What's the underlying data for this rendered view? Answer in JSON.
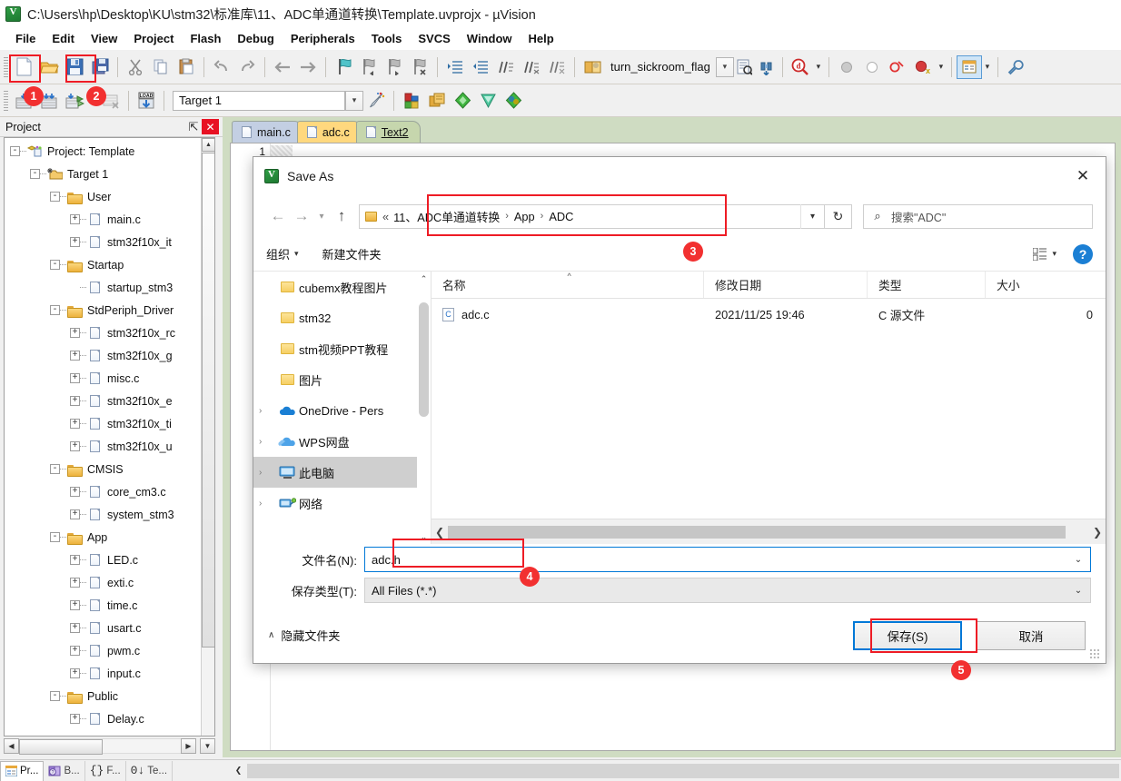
{
  "window": {
    "title": "C:\\Users\\hp\\Desktop\\KU\\stm32\\标准库\\11、ADC单通道转换\\Template.uvprojx - µVision",
    "app_icon": "keil-uvision-icon"
  },
  "menubar": {
    "items": [
      "File",
      "Edit",
      "View",
      "Project",
      "Flash",
      "Debug",
      "Peripherals",
      "Tools",
      "SVCS",
      "Window",
      "Help"
    ]
  },
  "toolbar1": {
    "buttons": [
      {
        "name": "new-file-button",
        "icon": "new-document-icon"
      },
      {
        "name": "open-file-button",
        "icon": "open-folder-icon"
      },
      {
        "name": "save-button",
        "icon": "floppy-save-icon"
      },
      {
        "name": "save-all-button",
        "icon": "save-all-icon"
      },
      {
        "name": "cut-button",
        "icon": "scissors-icon"
      },
      {
        "name": "copy-button",
        "icon": "copy-icon"
      },
      {
        "name": "paste-button",
        "icon": "paste-icon"
      },
      {
        "name": "undo-button",
        "icon": "undo-arrow-icon"
      },
      {
        "name": "redo-button",
        "icon": "redo-arrow-icon"
      },
      {
        "name": "navigate-back-button",
        "icon": "arrow-left-icon"
      },
      {
        "name": "navigate-forward-button",
        "icon": "arrow-right-icon"
      },
      {
        "name": "bookmark-toggle-button",
        "icon": "bookmark-flag-icon"
      },
      {
        "name": "bookmark-prev-button",
        "icon": "bookmark-prev-icon"
      },
      {
        "name": "bookmark-next-button",
        "icon": "bookmark-next-icon"
      },
      {
        "name": "bookmark-clear-button",
        "icon": "bookmark-clear-icon"
      },
      {
        "name": "indent-button",
        "icon": "indent-right-icon"
      },
      {
        "name": "outdent-button",
        "icon": "indent-left-icon"
      },
      {
        "name": "comment-button",
        "icon": "comment-lines-icon"
      },
      {
        "name": "uncomment-button",
        "icon": "uncomment-lines-icon"
      },
      {
        "name": "uncomment-alt-button",
        "icon": "uncomment-alt-icon"
      }
    ],
    "flag_value": "turn_sickroom_flag",
    "right_buttons": [
      {
        "name": "insert-file-button",
        "icon": "book-open-icon"
      },
      {
        "name": "find-in-files-button",
        "icon": "find-document-icon"
      },
      {
        "name": "find-next-button",
        "icon": "binoculars-icon"
      },
      {
        "name": "debug-query-button",
        "icon": "magnifier-q-icon"
      },
      {
        "name": "breakpoint-set-button",
        "icon": "grey-dot-icon"
      },
      {
        "name": "breakpoint-clear-button",
        "icon": "hollow-dot-icon"
      },
      {
        "name": "breakpoint-disable-button",
        "icon": "red-ring-icon"
      },
      {
        "name": "breakpoint-kill-all-button",
        "icon": "red-dot-x-icon"
      },
      {
        "name": "project-window-button",
        "icon": "window-panel-icon"
      },
      {
        "name": "configure-button",
        "icon": "wrench-icon"
      }
    ]
  },
  "toolbar2": {
    "buttons": [
      {
        "name": "translate-button",
        "icon": "translate-icon"
      },
      {
        "name": "build-button",
        "icon": "build-icon"
      },
      {
        "name": "rebuild-button",
        "icon": "rebuild-icon"
      },
      {
        "name": "batch-build-button",
        "icon": "batch-build-icon"
      },
      {
        "name": "download-button",
        "icon": "load-download-icon"
      }
    ],
    "target_value": "Target 1",
    "right_buttons": [
      {
        "name": "target-options-button",
        "icon": "magic-wand-icon"
      },
      {
        "name": "manage-project-items-button",
        "icon": "project-items-icon"
      },
      {
        "name": "manage-multi-project-button",
        "icon": "multi-project-icon"
      },
      {
        "name": "pack-installer-button",
        "icon": "green-diamond-icon"
      },
      {
        "name": "run-to-main-button",
        "icon": "teal-diamond-icon"
      },
      {
        "name": "pack-manager-button",
        "icon": "pack-manager-icon"
      }
    ]
  },
  "project_pane": {
    "title": "Project",
    "pin_icon": "pin-icon",
    "close_icon": "close-icon",
    "tree": [
      {
        "depth": 0,
        "expander": "-",
        "icon": "project-icon",
        "label": "Project: Template"
      },
      {
        "depth": 1,
        "expander": "-",
        "icon": "target-icon",
        "label": "Target 1"
      },
      {
        "depth": 2,
        "expander": "-",
        "icon": "folder-icon",
        "label": "User"
      },
      {
        "depth": 3,
        "expander": "+",
        "icon": "file-icon",
        "label": "main.c"
      },
      {
        "depth": 3,
        "expander": "+",
        "icon": "file-icon",
        "label": "stm32f10x_it"
      },
      {
        "depth": 2,
        "expander": "-",
        "icon": "folder-icon",
        "label": "Startap"
      },
      {
        "depth": 3,
        "expander": "",
        "icon": "file-icon",
        "label": "startup_stm3"
      },
      {
        "depth": 2,
        "expander": "-",
        "icon": "folder-icon",
        "label": "StdPeriph_Driver"
      },
      {
        "depth": 3,
        "expander": "+",
        "icon": "file-icon",
        "label": "stm32f10x_rc"
      },
      {
        "depth": 3,
        "expander": "+",
        "icon": "file-icon",
        "label": "stm32f10x_g"
      },
      {
        "depth": 3,
        "expander": "+",
        "icon": "file-icon",
        "label": "misc.c"
      },
      {
        "depth": 3,
        "expander": "+",
        "icon": "file-icon",
        "label": "stm32f10x_e"
      },
      {
        "depth": 3,
        "expander": "+",
        "icon": "file-icon",
        "label": "stm32f10x_ti"
      },
      {
        "depth": 3,
        "expander": "+",
        "icon": "file-icon",
        "label": "stm32f10x_u"
      },
      {
        "depth": 2,
        "expander": "-",
        "icon": "folder-icon",
        "label": "CMSIS"
      },
      {
        "depth": 3,
        "expander": "+",
        "icon": "file-icon",
        "label": "core_cm3.c"
      },
      {
        "depth": 3,
        "expander": "+",
        "icon": "file-icon",
        "label": "system_stm3"
      },
      {
        "depth": 2,
        "expander": "-",
        "icon": "folder-icon",
        "label": "App"
      },
      {
        "depth": 3,
        "expander": "+",
        "icon": "file-icon",
        "label": "LED.c"
      },
      {
        "depth": 3,
        "expander": "+",
        "icon": "file-icon",
        "label": "exti.c"
      },
      {
        "depth": 3,
        "expander": "+",
        "icon": "file-icon",
        "label": "time.c"
      },
      {
        "depth": 3,
        "expander": "+",
        "icon": "file-icon",
        "label": "usart.c"
      },
      {
        "depth": 3,
        "expander": "+",
        "icon": "file-icon",
        "label": "pwm.c"
      },
      {
        "depth": 3,
        "expander": "+",
        "icon": "file-icon",
        "label": "input.c"
      },
      {
        "depth": 2,
        "expander": "-",
        "icon": "folder-icon",
        "label": "Public"
      },
      {
        "depth": 3,
        "expander": "+",
        "icon": "file-icon",
        "label": "Delay.c"
      }
    ],
    "bottom_tabs": [
      {
        "name": "tab-project",
        "label": "Pr...",
        "icon": "project-tab-icon",
        "active": true
      },
      {
        "name": "tab-books",
        "label": "B...",
        "icon": "books-tab-icon",
        "active": false
      },
      {
        "name": "tab-functions",
        "label": "F...",
        "icon": "functions-tab-icon",
        "active": false
      },
      {
        "name": "tab-templates",
        "label": "Te...",
        "icon": "templates-tab-icon",
        "active": false
      }
    ]
  },
  "editor": {
    "tabs": [
      {
        "name": "editor-tab-mainc",
        "label": "main.c",
        "icon": "file-icon",
        "active": false
      },
      {
        "name": "editor-tab-adcc",
        "label": "adc.c",
        "icon": "file-icon",
        "active": false
      },
      {
        "name": "editor-tab-text2",
        "label": "Text2",
        "icon": "file-edit-icon",
        "active": true
      }
    ],
    "line_number": "1"
  },
  "dialog": {
    "title": "Save As",
    "icon": "keil-uvision-icon",
    "close_label": "✕",
    "nav": {
      "back_icon": "arrow-left-icon",
      "forward_icon": "arrow-right-icon",
      "recent_icon": "chevron-down-icon",
      "up_icon": "arrow-up-icon",
      "crumb_prefix": "«",
      "breadcrumbs": [
        "11、ADC单通道转换",
        "App",
        "ADC"
      ],
      "dropdown_icon": "chevron-down-icon",
      "refresh_icon": "refresh-icon",
      "search_icon": "search-icon",
      "search_placeholder": "搜索\"ADC\""
    },
    "commands": {
      "organize_label": "组织",
      "newfolder_label": "新建文件夹",
      "view_icon": "view-list-icon",
      "help_label": "?"
    },
    "sidenav": [
      {
        "name": "sidenav-cubemx",
        "label": "cubemx教程图片",
        "icon": "folder-icon",
        "chevron": false,
        "selected": false
      },
      {
        "name": "sidenav-stm32",
        "label": "stm32",
        "icon": "folder-icon",
        "chevron": false,
        "selected": false
      },
      {
        "name": "sidenav-stm-ppt",
        "label": "stm视频PPT教程",
        "icon": "folder-icon",
        "chevron": false,
        "selected": false
      },
      {
        "name": "sidenav-pictures",
        "label": "图片",
        "icon": "folder-icon",
        "chevron": false,
        "selected": false
      },
      {
        "name": "sidenav-onedrive",
        "label": "OneDrive - Pers",
        "icon": "onedrive-cloud-icon",
        "chevron": true,
        "selected": false
      },
      {
        "name": "sidenav-wps",
        "label": "WPS网盘",
        "icon": "wps-cloud-icon",
        "chevron": true,
        "selected": false
      },
      {
        "name": "sidenav-thispc",
        "label": "此电脑",
        "icon": "computer-icon",
        "chevron": true,
        "selected": true
      },
      {
        "name": "sidenav-network",
        "label": "网络",
        "icon": "network-icon",
        "chevron": true,
        "selected": false
      }
    ],
    "file_list": {
      "columns": [
        "名称",
        "修改日期",
        "类型",
        "大小"
      ],
      "rows": [
        {
          "name": "adc.c",
          "icon": "c-source-file-icon",
          "modified": "2021/11/25 19:46",
          "type": "C 源文件",
          "size": "0"
        }
      ]
    },
    "fields": {
      "filename_label": "文件名(N):",
      "filename_value": "adc.h",
      "filetype_label": "保存类型(T):",
      "filetype_value": "All Files (*.*)"
    },
    "footer": {
      "hide_folders_label": "隐藏文件夹",
      "hide_folders_caret": "∧",
      "save_label": "保存(S)",
      "cancel_label": "取消"
    }
  },
  "annotations": {
    "badges": [
      "1",
      "2",
      "3",
      "4",
      "5"
    ],
    "highlight_color": "#ee1c25",
    "badge_color": "#f23030"
  }
}
